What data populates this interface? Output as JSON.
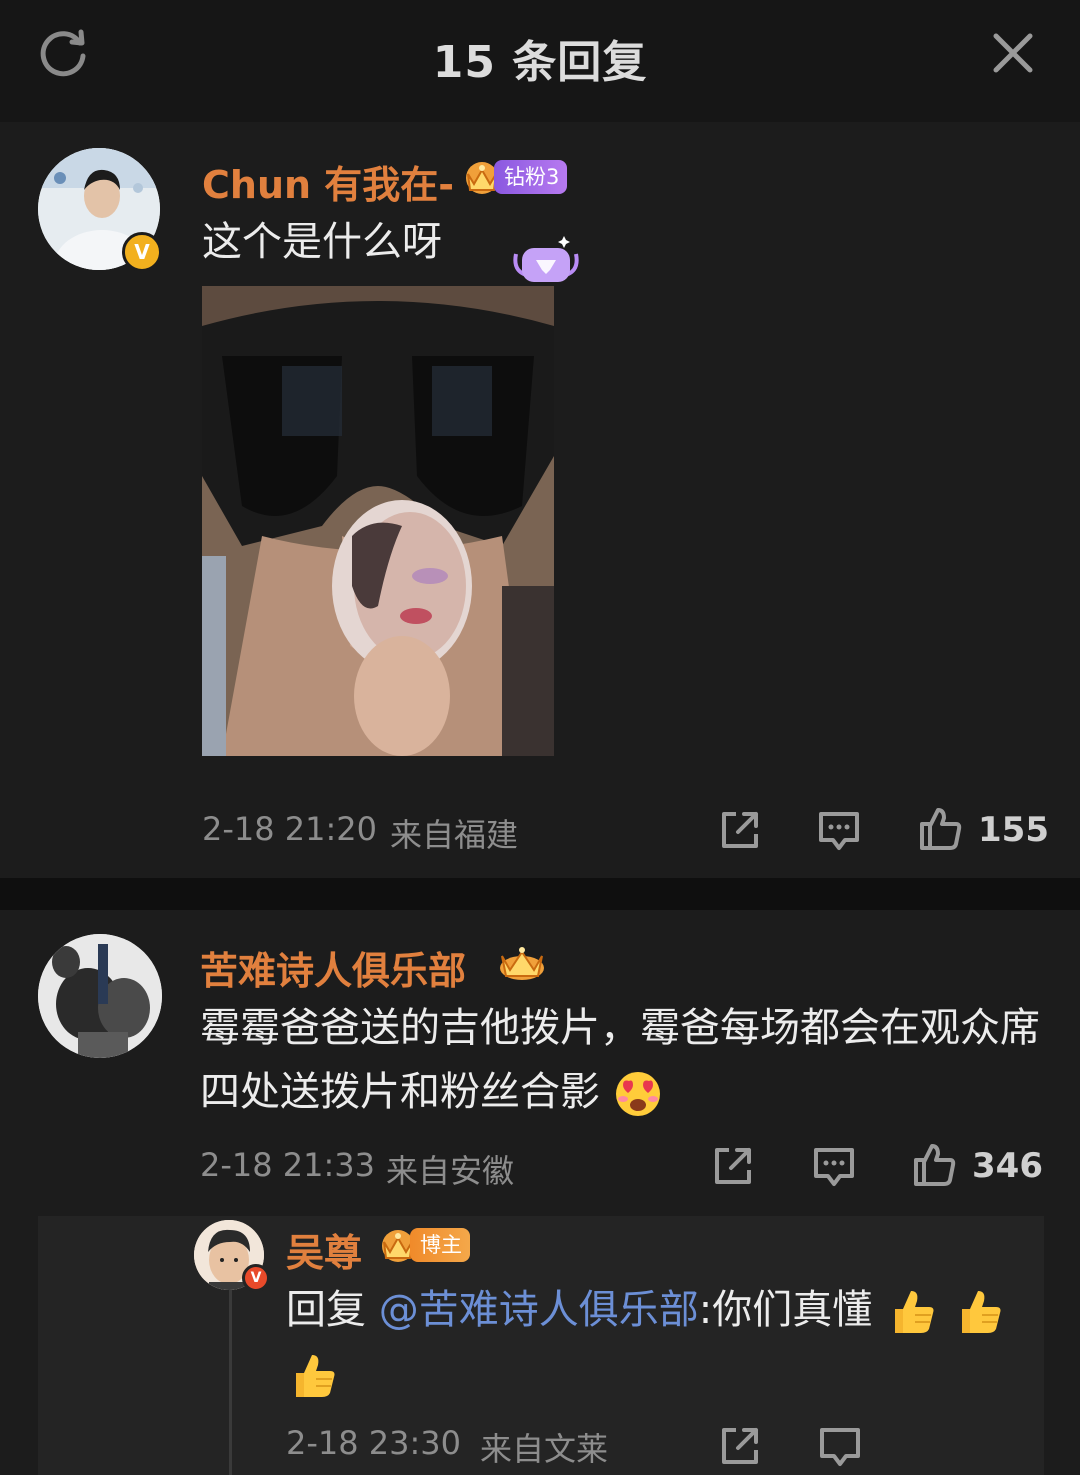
{
  "header": {
    "title": "15 条回复",
    "refresh_icon": "refresh-icon",
    "close_icon": "close-icon"
  },
  "comments": [
    {
      "username": "Chun 有我在-",
      "fan_badge": "钻粉3",
      "text": "这个是什么呀",
      "time": "2-18 21:20",
      "location": "来自福建",
      "likes": "155",
      "has_image": true
    },
    {
      "username": "苦难诗人俱乐部",
      "text": "霉霉爸爸送的吉他拨片，霉爸每场都会在观众席四处送拨片和粉丝合影",
      "time": "2-18 21:33",
      "location": "来自安徽",
      "likes": "346",
      "reply": {
        "username": "吴尊",
        "badge": "博主",
        "reply_prefix": "回复 ",
        "mention": "@苦难诗人俱乐部",
        "text": ":你们真懂",
        "time": "2-18 23:30",
        "location": "来自文莱"
      }
    }
  ],
  "colors": {
    "username": "#e1803e",
    "mention": "#6c8fd6",
    "verified": "#f2b01e",
    "fan_badge": "#a665e8"
  }
}
